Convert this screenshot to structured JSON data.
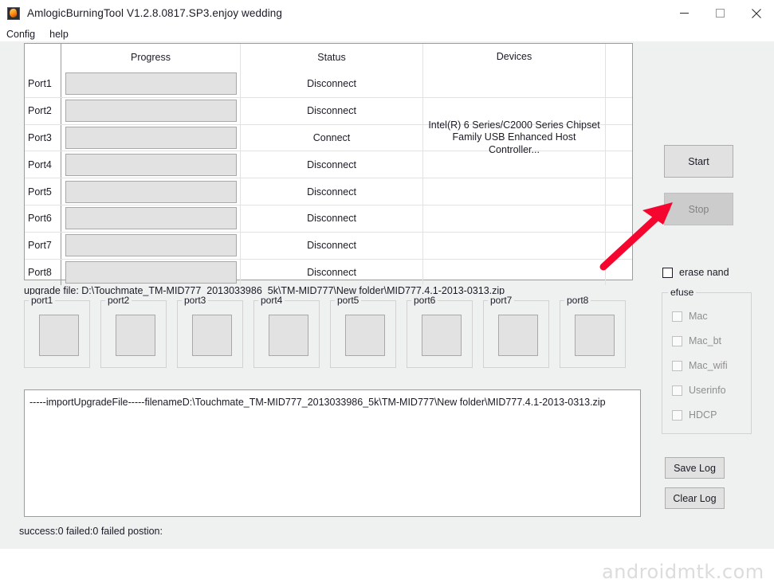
{
  "window": {
    "title": "AmlogicBurningTool  V1.2.8.0817.SP3.enjoy wedding",
    "icon": "app-flame-icon",
    "minimize_label": "minimize-icon",
    "maximize_label": "maximize-icon",
    "close_label": "close-icon"
  },
  "menubar": {
    "items": [
      {
        "label": "Config"
      },
      {
        "label": "help"
      }
    ]
  },
  "grid": {
    "headers": {
      "port": "",
      "progress": "Progress",
      "status": "Status",
      "devices": "Devices"
    },
    "rows": [
      {
        "port": "Port1",
        "progress": 0,
        "status": "Disconnect",
        "device": ""
      },
      {
        "port": "Port2",
        "progress": 0,
        "status": "Disconnect",
        "device": ""
      },
      {
        "port": "Port3",
        "progress": 0,
        "status": "Connect",
        "device": "Intel(R) 6 Series/C2000 Series Chipset\nFamily USB Enhanced Host Controller..."
      },
      {
        "port": "Port4",
        "progress": 0,
        "status": "Disconnect",
        "device": ""
      },
      {
        "port": "Port5",
        "progress": 0,
        "status": "Disconnect",
        "device": ""
      },
      {
        "port": "Port6",
        "progress": 0,
        "status": "Disconnect",
        "device": ""
      },
      {
        "port": "Port7",
        "progress": 0,
        "status": "Disconnect",
        "device": ""
      },
      {
        "port": "Port8",
        "progress": 0,
        "status": "Disconnect",
        "device": ""
      }
    ]
  },
  "upgrade_file": {
    "text": "upgrade file: D:\\Touchmate_TM-MID777_2013033986_5k\\TM-MID777\\New folder\\MID777.4.1-2013-0313.zip"
  },
  "port_boxes": [
    {
      "label": "port1"
    },
    {
      "label": "port2"
    },
    {
      "label": "port3"
    },
    {
      "label": "port4"
    },
    {
      "label": "port5"
    },
    {
      "label": "port6"
    },
    {
      "label": "port7"
    },
    {
      "label": "port8"
    }
  ],
  "log": {
    "lines": [
      "-----importUpgradeFile-----filenameD:\\Touchmate_TM-MID777_2013033986_5k\\TM-MID777\\New folder\\MID777.4.1-2013-0313.zip"
    ]
  },
  "statusbar": {
    "text": "success:0 failed:0 failed postion:"
  },
  "controls": {
    "start_label": "Start",
    "stop_label": "Stop",
    "save_log_label": "Save Log",
    "clear_log_label": "Clear Log",
    "erase_nand_label": "erase nand",
    "erase_nand_checked": false
  },
  "efuse": {
    "title": "efuse",
    "items": [
      {
        "label": "Mac",
        "checked": false,
        "enabled": false
      },
      {
        "label": "Mac_bt",
        "checked": false,
        "enabled": false
      },
      {
        "label": "Mac_wifi",
        "checked": false,
        "enabled": false
      },
      {
        "label": "Userinfo",
        "checked": false,
        "enabled": false
      },
      {
        "label": "HDCP",
        "checked": false,
        "enabled": false
      }
    ]
  },
  "watermarks": {
    "top": "androidmtk.com",
    "bottom": "androidmtk.com"
  },
  "annotation": {
    "arrow_color": "#F5062E",
    "points_to": "start-button"
  }
}
